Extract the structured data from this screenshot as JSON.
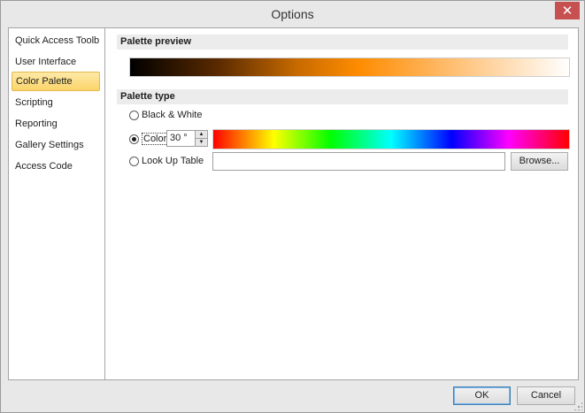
{
  "window": {
    "title": "Options",
    "close_glyph": "✕"
  },
  "nav": {
    "items": [
      {
        "label": "Quick Access Toolb..."
      },
      {
        "label": "User Interface"
      },
      {
        "label": "Color Palette",
        "selected": true
      },
      {
        "label": "Scripting"
      },
      {
        "label": "Reporting"
      },
      {
        "label": "Gallery Settings"
      },
      {
        "label": "Access Code"
      }
    ]
  },
  "preview": {
    "header": "Palette preview"
  },
  "palette_type": {
    "header": "Palette type",
    "options": {
      "bw": {
        "label": "Black & White",
        "checked": false
      },
      "color": {
        "label": "Color",
        "checked": true
      },
      "lut": {
        "label": "Look Up Table",
        "checked": false
      }
    },
    "angle_value": "30 °",
    "lut_path": "",
    "browse_label": "Browse..."
  },
  "footer": {
    "ok_label": "OK",
    "cancel_label": "Cancel"
  },
  "colors": {
    "accent": "#ff8c00",
    "selected_nav": "#fbd56a",
    "close_button": "#c75050"
  },
  "icons": {
    "close": "close-icon",
    "spin_up": "spin-up-icon",
    "spin_down": "spin-down-icon",
    "grip": "size-grip-icon"
  }
}
